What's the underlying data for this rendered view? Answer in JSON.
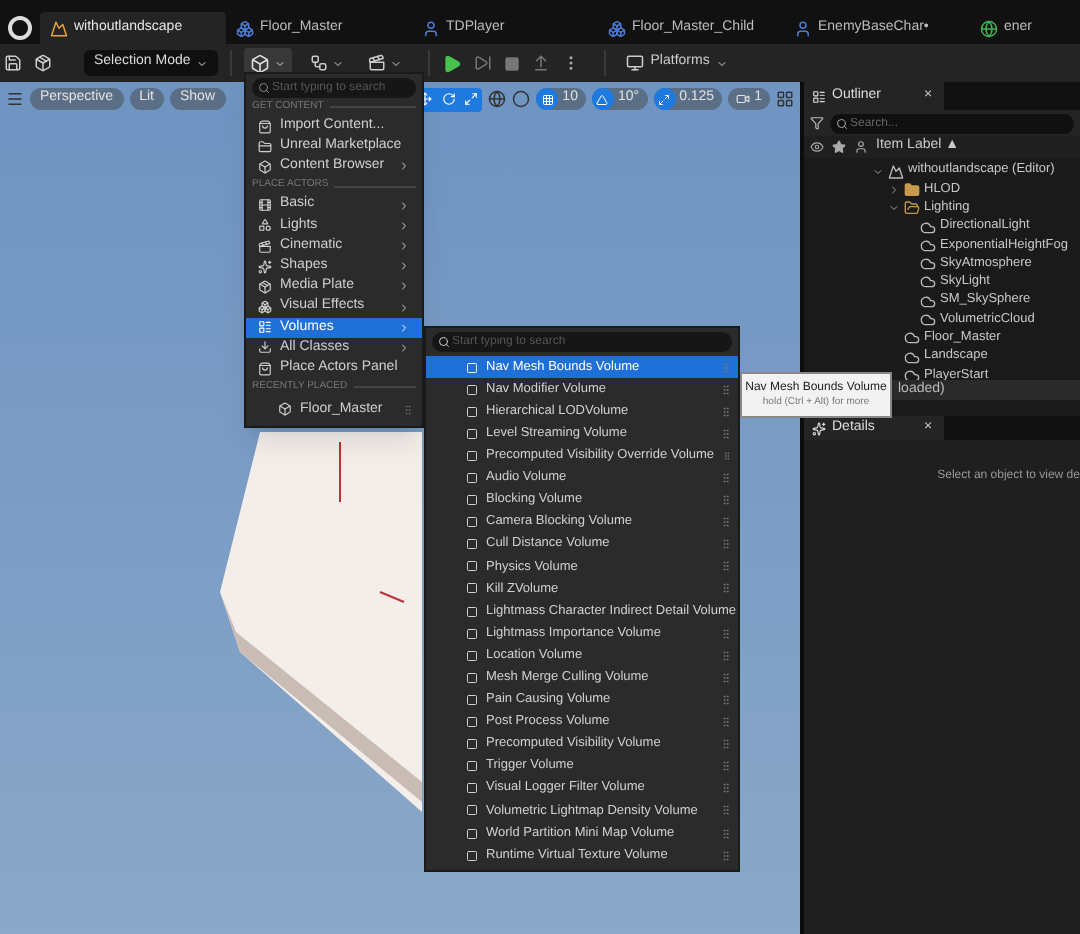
{
  "tabs": [
    {
      "label": "withoutlandscape",
      "kind": "level",
      "selected": true
    },
    {
      "label": "Floor_Master",
      "kind": "blueprint",
      "selected": false
    },
    {
      "label": "TDPlayer",
      "kind": "character",
      "selected": false
    },
    {
      "label": "Floor_Master_Child",
      "kind": "blueprint",
      "selected": false
    },
    {
      "label": "EnemyBaseChar•",
      "kind": "character",
      "selected": false
    },
    {
      "label": "ener",
      "kind": "online",
      "selected": false
    }
  ],
  "toolbar": {
    "mode": "Selection Mode",
    "platforms": "Platforms"
  },
  "viewport_toolbar": {
    "left": [
      "Perspective",
      "Lit",
      "Show"
    ],
    "grid": "10",
    "angle": "10°",
    "scale": "0.125",
    "camera": "1"
  },
  "add_menu": {
    "placeholder": "Start typing to search",
    "items": [
      {
        "kind": "header",
        "label": "GET CONTENT"
      },
      {
        "kind": "item",
        "label": "Import Content...",
        "submenu": false,
        "selected": false
      },
      {
        "kind": "item",
        "label": "Unreal Marketplace",
        "submenu": false,
        "selected": false
      },
      {
        "kind": "item",
        "label": "Content Browser",
        "submenu": true,
        "selected": false
      },
      {
        "kind": "header",
        "label": "PLACE ACTORS"
      },
      {
        "kind": "item",
        "label": "Basic",
        "submenu": true,
        "selected": false
      },
      {
        "kind": "item",
        "label": "Lights",
        "submenu": true,
        "selected": false
      },
      {
        "kind": "item",
        "label": "Cinematic",
        "submenu": true,
        "selected": false
      },
      {
        "kind": "item",
        "label": "Shapes",
        "submenu": true,
        "selected": false
      },
      {
        "kind": "item",
        "label": "Media Plate",
        "submenu": true,
        "selected": false
      },
      {
        "kind": "item",
        "label": "Visual Effects",
        "submenu": true,
        "selected": false
      },
      {
        "kind": "item",
        "label": "Volumes",
        "submenu": true,
        "selected": true
      },
      {
        "kind": "item",
        "label": "All Classes",
        "submenu": true,
        "selected": false
      },
      {
        "kind": "item",
        "label": "Place Actors Panel",
        "submenu": false,
        "selected": false
      },
      {
        "kind": "header",
        "label": "RECENTLY PLACED"
      },
      {
        "kind": "recent",
        "label": "Floor_Master"
      }
    ]
  },
  "volumes_menu": {
    "placeholder": "Start typing to search",
    "items": [
      {
        "label": "Nav Mesh Bounds Volume",
        "selected": true
      },
      {
        "label": "Nav Modifier Volume",
        "selected": false
      },
      {
        "label": "Hierarchical LODVolume",
        "selected": false
      },
      {
        "label": "Level Streaming Volume",
        "selected": false
      },
      {
        "label": "Precomputed Visibility Override Volume",
        "selected": false
      },
      {
        "label": "Audio Volume",
        "selected": false
      },
      {
        "label": "Blocking Volume",
        "selected": false
      },
      {
        "label": "Camera Blocking Volume",
        "selected": false
      },
      {
        "label": "Cull Distance Volume",
        "selected": false
      },
      {
        "label": "Physics Volume",
        "selected": false
      },
      {
        "label": "Kill ZVolume",
        "selected": false
      },
      {
        "label": "Lightmass Character Indirect Detail Volume",
        "selected": false
      },
      {
        "label": "Lightmass Importance Volume",
        "selected": false
      },
      {
        "label": "Location Volume",
        "selected": false
      },
      {
        "label": "Mesh Merge Culling Volume",
        "selected": false
      },
      {
        "label": "Pain Causing Volume",
        "selected": false
      },
      {
        "label": "Post Process Volume",
        "selected": false
      },
      {
        "label": "Precomputed Visibility Volume",
        "selected": false
      },
      {
        "label": "Trigger Volume",
        "selected": false
      },
      {
        "label": "Visual Logger Filter Volume",
        "selected": false
      },
      {
        "label": "Volumetric Lightmap Density Volume",
        "selected": false
      },
      {
        "label": "World Partition Mini Map Volume",
        "selected": false
      },
      {
        "label": "Runtime Virtual Texture Volume",
        "selected": false
      }
    ]
  },
  "tooltip": {
    "title": "Nav Mesh Bounds Volume",
    "hint": "hold (Ctrl + Alt) for more"
  },
  "outliner": {
    "title": "Outliner",
    "close": "×",
    "search_placeholder": "Search...",
    "column": "Item Label ▲",
    "tree": [
      {
        "label": "withoutlandscape (Editor)",
        "kind": "level",
        "expanded": true,
        "children": [
          {
            "label": "HLOD",
            "kind": "folder",
            "expanded": false
          },
          {
            "label": "Lighting",
            "kind": "folder",
            "expanded": true,
            "children": [
              {
                "label": "DirectionalLight",
                "kind": "actor"
              },
              {
                "label": "ExponentialHeightFog",
                "kind": "actor"
              },
              {
                "label": "SkyAtmosphere",
                "kind": "actor"
              },
              {
                "label": "SkyLight",
                "kind": "actor"
              },
              {
                "label": "SM_SkySphere",
                "kind": "actor"
              },
              {
                "label": "VolumetricCloud",
                "kind": "actor"
              }
            ]
          },
          {
            "label": "Floor_Master",
            "kind": "actor"
          },
          {
            "label": "Landscape",
            "kind": "actor"
          },
          {
            "label": "PlayerStart",
            "kind": "actor"
          }
        ]
      }
    ],
    "status": "loaded)"
  },
  "details": {
    "title": "Details",
    "close": "×",
    "empty": "Select an object to view de"
  }
}
